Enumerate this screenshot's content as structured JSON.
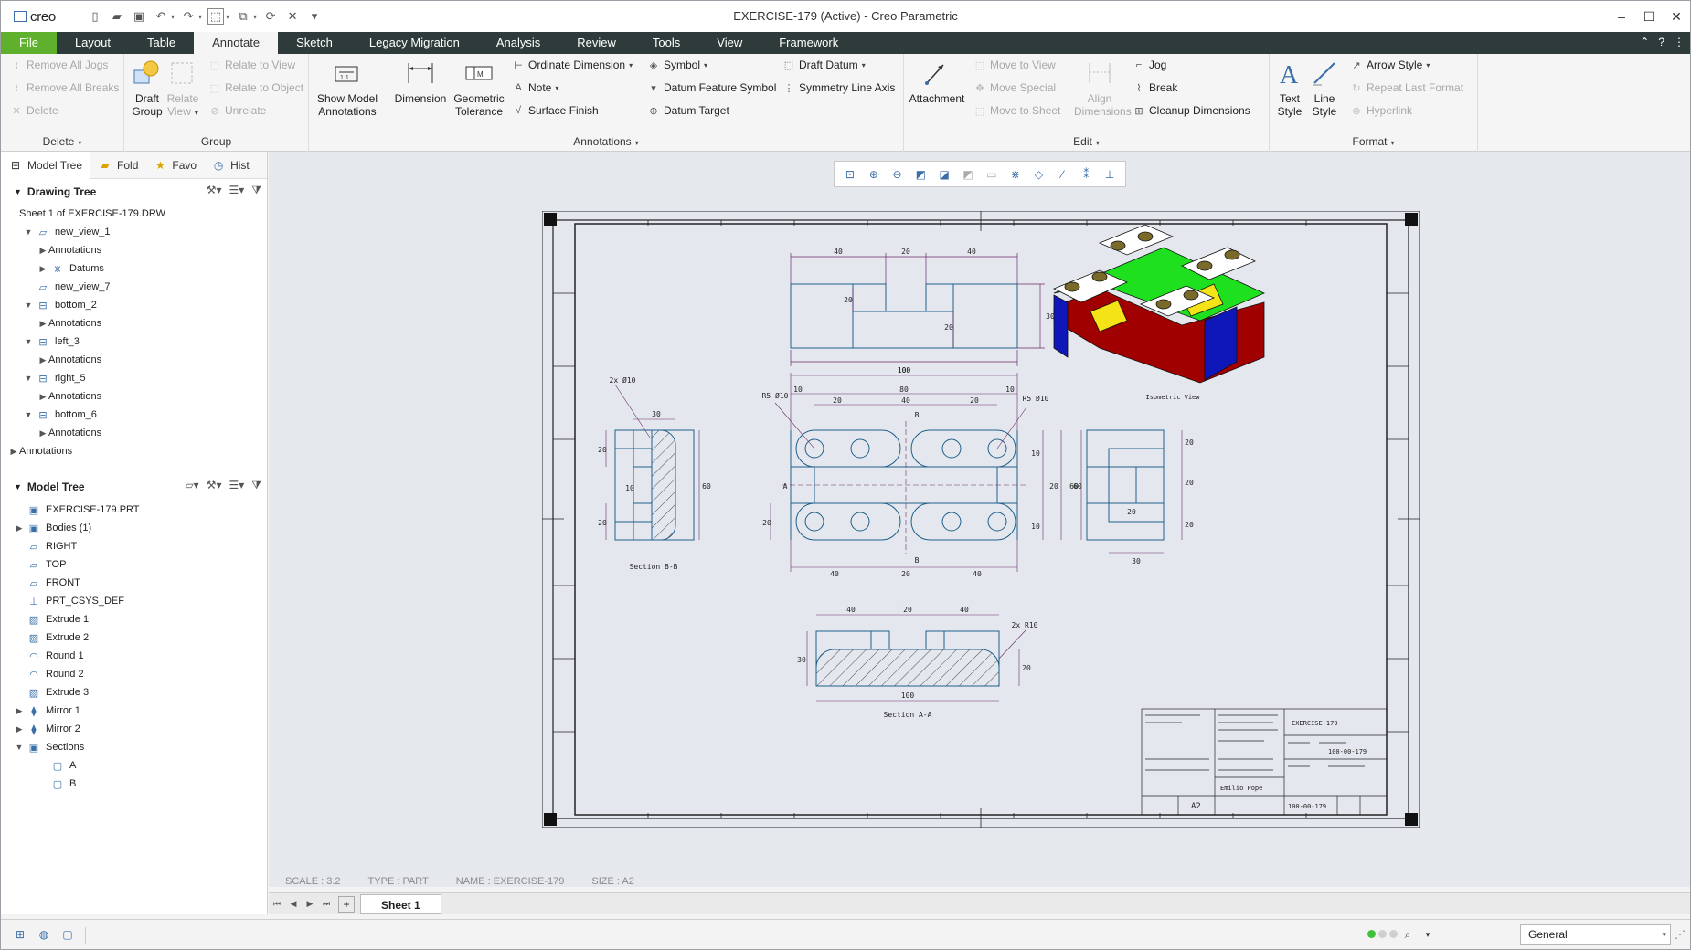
{
  "app": {
    "logo_text": "creo",
    "window_title": "EXERCISE-179 (Active) - Creo Parametric"
  },
  "tabs": [
    "File",
    "Layout",
    "Table",
    "Annotate",
    "Sketch",
    "Legacy Migration",
    "Analysis",
    "Review",
    "Tools",
    "View",
    "Framework"
  ],
  "ribbon": {
    "delete_group": {
      "label": "Delete",
      "remove_all_jogs": "Remove All Jogs",
      "remove_all_breaks": "Remove All Breaks",
      "delete": "Delete"
    },
    "group_group": {
      "label": "Group",
      "draft_group": "Draft Group",
      "relate_view": "Relate View",
      "relate_to_view": "Relate to View",
      "relate_to_object": "Relate to Object",
      "unrelate": "Unrelate"
    },
    "annotations_group": {
      "label": "Annotations",
      "show_model_annotations": "Show Model Annotations",
      "dimension": "Dimension",
      "geometric_tolerance": "Geometric Tolerance",
      "ordinate_dimension": "Ordinate Dimension",
      "note": "Note",
      "surface_finish": "Surface Finish",
      "symbol": "Symbol",
      "datum_feature_symbol": "Datum Feature Symbol",
      "datum_target": "Datum Target",
      "draft_datum": "Draft Datum",
      "symmetry_line_axis": "Symmetry Line Axis"
    },
    "edit_group": {
      "label": "Edit",
      "attachment": "Attachment",
      "move_to_view": "Move to View",
      "move_special": "Move Special",
      "move_to_sheet": "Move to Sheet",
      "align_dimensions": "Align Dimensions",
      "jog": "Jog",
      "break": "Break",
      "cleanup_dimensions": "Cleanup Dimensions"
    },
    "format_group": {
      "label": "Format",
      "text_style": "Text Style",
      "line_style": "Line Style",
      "arrow_style": "Arrow Style",
      "repeat_last_format": "Repeat Last Format",
      "hyperlink": "Hyperlink"
    }
  },
  "navigator": {
    "tabs": [
      "Model Tree",
      "Fold",
      "Favo",
      "Hist"
    ],
    "drawing_tree": {
      "title": "Drawing Tree",
      "items": [
        {
          "label": "Sheet 1 of EXERCISE-179.DRW",
          "level": 0
        },
        {
          "label": "new_view_1",
          "level": 1
        },
        {
          "label": "Annotations",
          "level": 2
        },
        {
          "label": "Datums",
          "level": 2
        },
        {
          "label": "new_view_7",
          "level": 1
        },
        {
          "label": "bottom_2",
          "level": 1
        },
        {
          "label": "Annotations",
          "level": 2
        },
        {
          "label": "left_3",
          "level": 1
        },
        {
          "label": "Annotations",
          "level": 2
        },
        {
          "label": "right_5",
          "level": 1
        },
        {
          "label": "Annotations",
          "level": 2
        },
        {
          "label": "bottom_6",
          "level": 1
        },
        {
          "label": "Annotations",
          "level": 2
        },
        {
          "label": "Annotations",
          "level": 0
        }
      ]
    },
    "model_tree": {
      "title": "Model Tree",
      "items": [
        {
          "label": "EXERCISE-179.PRT"
        },
        {
          "label": "Bodies (1)"
        },
        {
          "label": "RIGHT"
        },
        {
          "label": "TOP"
        },
        {
          "label": "FRONT"
        },
        {
          "label": "PRT_CSYS_DEF"
        },
        {
          "label": "Extrude 1"
        },
        {
          "label": "Extrude 2"
        },
        {
          "label": "Round 1"
        },
        {
          "label": "Round 2"
        },
        {
          "label": "Extrude 3"
        },
        {
          "label": "Mirror 1"
        },
        {
          "label": "Mirror 2"
        },
        {
          "label": "Sections"
        },
        {
          "label": "A"
        },
        {
          "label": "B"
        }
      ]
    }
  },
  "drawing": {
    "status": {
      "scale": "SCALE : 3.2",
      "type": "TYPE : PART",
      "name": "NAME : EXERCISE-179",
      "size": "SIZE : A2"
    },
    "labels": {
      "section_bb": "Section B-B",
      "section_aa": "Section A-A",
      "isometric": "Isometric View",
      "title_name": "EXERCISE-179",
      "title_size": "A2",
      "title_drawn": "Emilio Pope",
      "title_docno": "100-00-179",
      "title_docno2": "100-00-179"
    },
    "dims": {
      "top_40a": "40",
      "top_20": "20",
      "top_40b": "40",
      "top_20h": "20",
      "top_20v": "20",
      "top_30": "30",
      "top_100": "100",
      "plan_100": "100",
      "plan_10a": "10",
      "plan_80": "80",
      "plan_10b": "10",
      "plan_20a": "20",
      "plan_40": "40",
      "plan_20b": "20",
      "plan_r5a": "R5 Ø10",
      "plan_r5b": "R5 Ø10",
      "plan_b": "B",
      "plan_a": "A",
      "plan_60": "60",
      "plan_20c": "20",
      "plan_20d": "20",
      "plan_10c": "10",
      "plan_10d": "10",
      "plan_40b": "40",
      "plan_20e": "20",
      "plan_40c": "40",
      "left_30": "30",
      "left_r": "2x Ø10",
      "left_20a": "20",
      "left_10": "10",
      "left_20b": "20",
      "left_60": "60",
      "right_20a": "20",
      "right_20b": "20",
      "right_20c": "20",
      "right_60": "60",
      "right_20d": "20",
      "right_30": "30",
      "bot_40a": "40",
      "bot_20": "20",
      "bot_40b": "40",
      "bot_30": "30",
      "bot_20v": "20",
      "bot_100": "100",
      "bot_r": "2x R10"
    },
    "iso_colors": {
      "top": "#ffffff",
      "face_red": "#a00000",
      "face_green": "#1fe01f",
      "face_yellow": "#f4e316",
      "face_blue": "#0f17b8",
      "hole": "#7a6a2a"
    }
  },
  "sheet_tab": "Sheet 1",
  "filter": {
    "value": "General"
  }
}
